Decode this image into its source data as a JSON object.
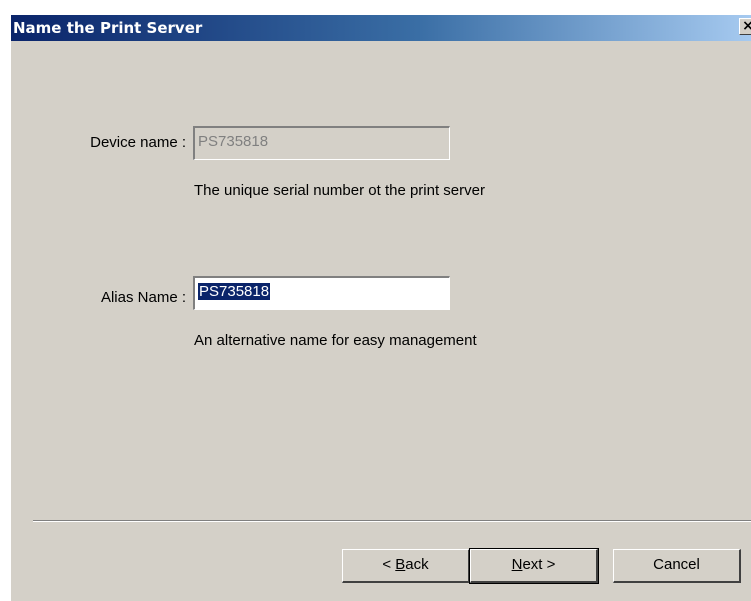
{
  "window": {
    "title": "Name the Print Server",
    "close_glyph": "×"
  },
  "device": {
    "label": "Device name :",
    "value": "PS735818",
    "hint": "The unique serial number ot the print server"
  },
  "alias": {
    "label": "Alias Name :",
    "value": "PS735818",
    "hint": "An alternative name for easy management"
  },
  "buttons": {
    "back_prefix": "< ",
    "back_mnemonic": "B",
    "back_rest": "ack",
    "next_mnemonic": "N",
    "next_rest": "ext >",
    "cancel_label": "Cancel"
  }
}
